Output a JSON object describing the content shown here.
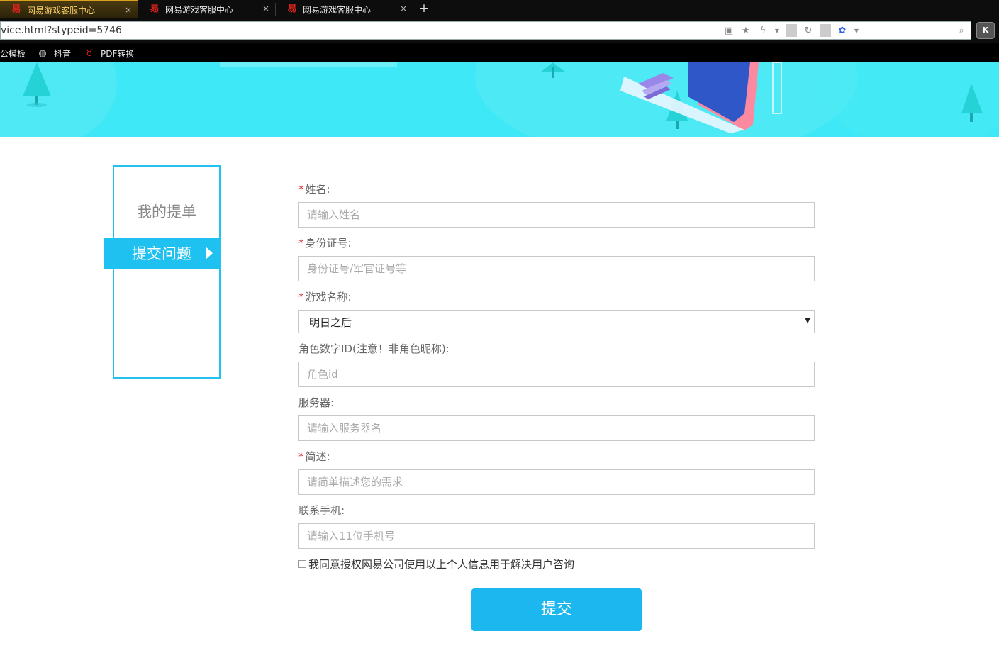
{
  "browser": {
    "tabs": [
      {
        "title": "网易游戏客服中心",
        "icon": "netease-logo-icon",
        "active": true
      },
      {
        "title": "网易游戏客服中心",
        "icon": "netease-logo-icon",
        "active": false
      },
      {
        "title": "网易游戏客服中心",
        "icon": "netease-logo-icon",
        "active": false
      }
    ],
    "new_tab_label": "+",
    "close_label": "×",
    "url": "vice.html?stypeid=5746",
    "extension_label": "K",
    "bookmarks": [
      {
        "label": "公模板",
        "icon": "folder-icon"
      },
      {
        "label": "抖音",
        "icon": "globe-icon"
      },
      {
        "label": "PDF转换",
        "icon": "pdf-convert-icon"
      }
    ]
  },
  "sidebar": {
    "items": [
      {
        "label": "我的提单",
        "active": false
      },
      {
        "label": "提交问题",
        "active": true
      }
    ]
  },
  "form": {
    "required_mark": "*",
    "fields": {
      "name": {
        "label": "姓名:",
        "placeholder": "请输入姓名",
        "required": true
      },
      "id_card": {
        "label": "身份证号:",
        "placeholder": "身份证号/军官证号等",
        "required": true
      },
      "game": {
        "label": "游戏名称:",
        "value": "明日之后",
        "required": true
      },
      "role_id": {
        "label": "角色数字ID(注意！非角色昵称):",
        "placeholder": "角色id",
        "required": false
      },
      "server": {
        "label": "服务器:",
        "placeholder": "请输入服务器名",
        "required": false
      },
      "description": {
        "label": "简述:",
        "placeholder": "请简单描述您的需求",
        "required": true
      },
      "phone": {
        "label": "联系手机:",
        "placeholder": "请输入11位手机号",
        "required": false
      }
    },
    "agree_text": "我同意授权网易公司使用以上个人信息用于解决用户咨询",
    "submit_label": "提交"
  },
  "colors": {
    "accent": "#1ec1ef",
    "banner_bg": "#3ee8f6",
    "required": "#e02020",
    "submit_bg": "#1cb7ef"
  }
}
